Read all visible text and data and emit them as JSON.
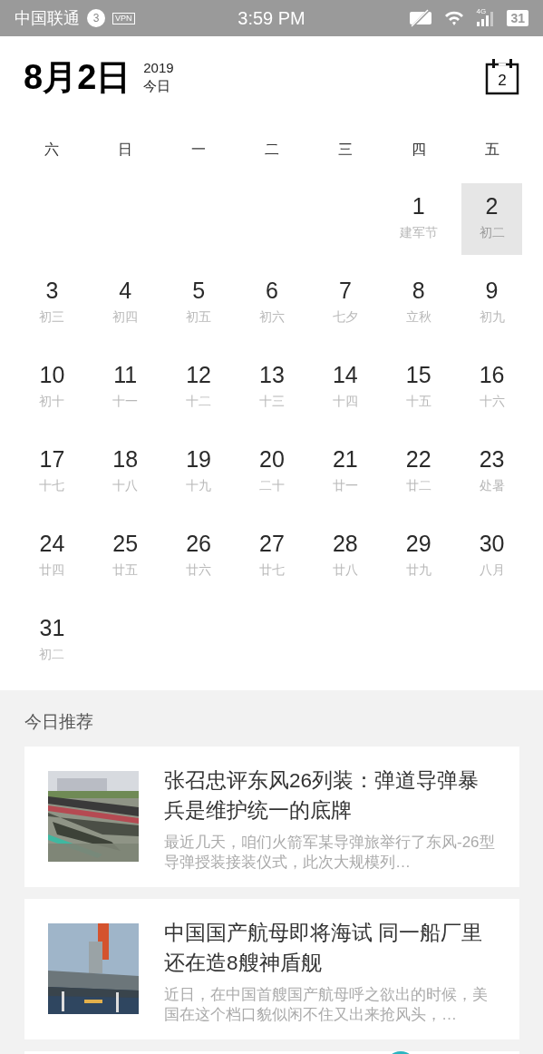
{
  "status_bar": {
    "carrier": "中国联通",
    "notification_count": "3",
    "vpn": "VPN",
    "time": "3:59 PM",
    "network": "4G",
    "battery": "31"
  },
  "header": {
    "date": "8月2日",
    "year": "2019",
    "today_label": "今日",
    "calendar_button_day": "2"
  },
  "weekdays": [
    "六",
    "日",
    "一",
    "二",
    "三",
    "四",
    "五"
  ],
  "weeks": [
    [
      {
        "day": "1",
        "lunar": "建军节",
        "selected": false
      },
      {
        "day": "2",
        "lunar": "初二",
        "selected": true
      }
    ],
    [
      {
        "day": "3",
        "lunar": "初三",
        "selected": false
      },
      {
        "day": "4",
        "lunar": "初四",
        "selected": false
      },
      {
        "day": "5",
        "lunar": "初五",
        "selected": false
      },
      {
        "day": "6",
        "lunar": "初六",
        "selected": false
      },
      {
        "day": "7",
        "lunar": "七夕",
        "selected": false
      },
      {
        "day": "8",
        "lunar": "立秋",
        "selected": false
      },
      {
        "day": "9",
        "lunar": "初九",
        "selected": false
      }
    ],
    [
      {
        "day": "10",
        "lunar": "初十",
        "selected": false
      },
      {
        "day": "11",
        "lunar": "十一",
        "selected": false
      },
      {
        "day": "12",
        "lunar": "十二",
        "selected": false
      },
      {
        "day": "13",
        "lunar": "十三",
        "selected": false
      },
      {
        "day": "14",
        "lunar": "十四",
        "selected": false
      },
      {
        "day": "15",
        "lunar": "十五",
        "selected": false
      },
      {
        "day": "16",
        "lunar": "十六",
        "selected": false
      }
    ],
    [
      {
        "day": "17",
        "lunar": "十七",
        "selected": false
      },
      {
        "day": "18",
        "lunar": "十八",
        "selected": false
      },
      {
        "day": "19",
        "lunar": "十九",
        "selected": false
      },
      {
        "day": "20",
        "lunar": "二十",
        "selected": false
      },
      {
        "day": "21",
        "lunar": "廿一",
        "selected": false
      },
      {
        "day": "22",
        "lunar": "廿二",
        "selected": false
      },
      {
        "day": "23",
        "lunar": "处暑",
        "selected": false
      }
    ],
    [
      {
        "day": "24",
        "lunar": "廿四",
        "selected": false
      },
      {
        "day": "25",
        "lunar": "廿五",
        "selected": false
      },
      {
        "day": "26",
        "lunar": "廿六",
        "selected": false
      },
      {
        "day": "27",
        "lunar": "廿七",
        "selected": false
      },
      {
        "day": "28",
        "lunar": "廿八",
        "selected": false
      },
      {
        "day": "29",
        "lunar": "廿九",
        "selected": false
      },
      {
        "day": "30",
        "lunar": "八月",
        "selected": false
      }
    ],
    [
      {
        "day": "31",
        "lunar": "初二",
        "selected": false
      }
    ]
  ],
  "recommendations": {
    "heading": "今日推荐",
    "items": [
      {
        "kind": "article",
        "title": "张召忠评东风26列装：弹道导弹暴兵是维护统一的底牌",
        "summary": "最近几天，咱们火箭军某导弹旅举行了东风-26型导弹授装接装仪式，此次大规模列…"
      },
      {
        "kind": "article",
        "title": "中国国产航母即将海试 同一船厂里还在造8艘神盾舰",
        "summary": "近日，在中国首艘国产航母呼之欲出的时候，美国在这个档口貌似闲不住又出来抢风头，…"
      },
      {
        "kind": "partial"
      }
    ]
  }
}
